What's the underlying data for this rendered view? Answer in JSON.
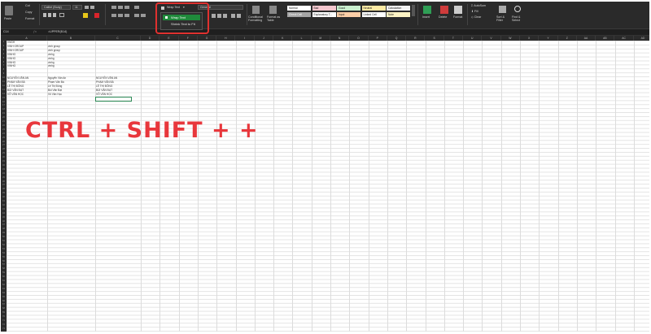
{
  "ribbon": {
    "clipboard": {
      "paste": "Paste",
      "cut": "Cut",
      "copy": "Copy",
      "format": "Format"
    },
    "font": {
      "name": "Calibri (Body)",
      "size": "11"
    },
    "alignment": {
      "wrap_text": "Wrap Text",
      "merge": "Merge"
    },
    "number": {
      "format": "General"
    },
    "styles": {
      "conditional": "Conditional Formatting",
      "format_table": "Format as Table",
      "cells": [
        {
          "label": "Normal",
          "bg": "#ffffff"
        },
        {
          "label": "Bad",
          "bg": "#f4c7ce"
        },
        {
          "label": "Good",
          "bg": "#c9efce"
        },
        {
          "label": "Neutral",
          "bg": "#fdeaa3"
        },
        {
          "label": "Calculation",
          "bg": "#f2f2f2"
        },
        {
          "label": "Check Cell",
          "bg": "#a5a5a5"
        },
        {
          "label": "Explanatory T...",
          "bg": "#ffffff"
        },
        {
          "label": "Input",
          "bg": "#fbcea7"
        },
        {
          "label": "Linked Cell",
          "bg": "#ffffff"
        },
        {
          "label": "Note",
          "bg": "#fdf3c4"
        }
      ]
    },
    "cells_group": {
      "insert": "Insert",
      "delete": "Delete",
      "format": "Format"
    },
    "editing": {
      "autosum": "AutoSum",
      "fill": "Fill",
      "clear": "Clear",
      "sort": "Sort & Filter",
      "find": "Find & Select"
    }
  },
  "dropdown": {
    "wrap_text": "Wrap Text",
    "shrink": "Shrink Text to Fit"
  },
  "formula_bar": {
    "name_box": "C14",
    "formula": "=UPPER(B14)"
  },
  "columns": [
    "A",
    "B",
    "C",
    "D",
    "E",
    "F",
    "G",
    "H",
    "I",
    "J",
    "K",
    "L",
    "M",
    "N",
    "O",
    "P",
    "Q",
    "R",
    "S",
    "T",
    "U",
    "V",
    "W",
    "X",
    "Y",
    "Z",
    "AA",
    "AB",
    "AC",
    "AD",
    "AE"
  ],
  "cells": [
    {
      "row": 1,
      "col": "A",
      "text": "VNGH"
    },
    {
      "row": 2,
      "col": "A",
      "text": "VINH GROUP"
    },
    {
      "row": 2,
      "col": "B",
      "text": "vinh group"
    },
    {
      "row": 3,
      "col": "A",
      "text": "VINH GROUP"
    },
    {
      "row": 3,
      "col": "B",
      "text": "vinh group"
    },
    {
      "row": 4,
      "col": "A",
      "text": "VINHG"
    },
    {
      "row": 4,
      "col": "B",
      "text": "vinhg"
    },
    {
      "row": 5,
      "col": "A",
      "text": "VINHG"
    },
    {
      "row": 5,
      "col": "B",
      "text": "vinhg"
    },
    {
      "row": 6,
      "col": "A",
      "text": "VINHG"
    },
    {
      "row": 6,
      "col": "B",
      "text": "vinhg"
    },
    {
      "row": 7,
      "col": "A",
      "text": "VINHG"
    },
    {
      "row": 7,
      "col": "B",
      "text": "vinhg"
    },
    {
      "row": 10,
      "col": "A",
      "text": "NGUYỄN VĂN AN"
    },
    {
      "row": 10,
      "col": "B",
      "text": "Nguyễn Văn An"
    },
    {
      "row": 10,
      "col": "C",
      "text": "NGUYỄN VĂN AN"
    },
    {
      "row": 11,
      "col": "A",
      "text": "PHẠM VĂN BÁ"
    },
    {
      "row": 11,
      "col": "B",
      "text": "Phạm Văn Bá"
    },
    {
      "row": 11,
      "col": "C",
      "text": "PHẠM VĂN BÁ"
    },
    {
      "row": 12,
      "col": "A",
      "text": "LÊ THỊ ĐÔNG"
    },
    {
      "row": 12,
      "col": "B",
      "text": "Lê Thị Đông"
    },
    {
      "row": 12,
      "col": "C",
      "text": "LÊ THỊ ĐÔNG"
    },
    {
      "row": 13,
      "col": "A",
      "text": "BÙI VĂN ĐẠT"
    },
    {
      "row": 13,
      "col": "B",
      "text": "Bùi Văn Đạt"
    },
    {
      "row": 13,
      "col": "C",
      "text": "BÙI VĂN ĐẠT"
    },
    {
      "row": 14,
      "col": "A",
      "text": "VÕ VĂN HỌC"
    },
    {
      "row": 14,
      "col": "B",
      "text": "Võ Văn Học"
    },
    {
      "row": 14,
      "col": "C",
      "text": "VÕ VĂN HỌC"
    }
  ],
  "overlay": {
    "shortcut": "CTRL + SHIFT + +"
  },
  "colors": {
    "highlight": "#e0312f",
    "wrap_active": "#1f8a3b",
    "shortcut": "#e8373c"
  }
}
